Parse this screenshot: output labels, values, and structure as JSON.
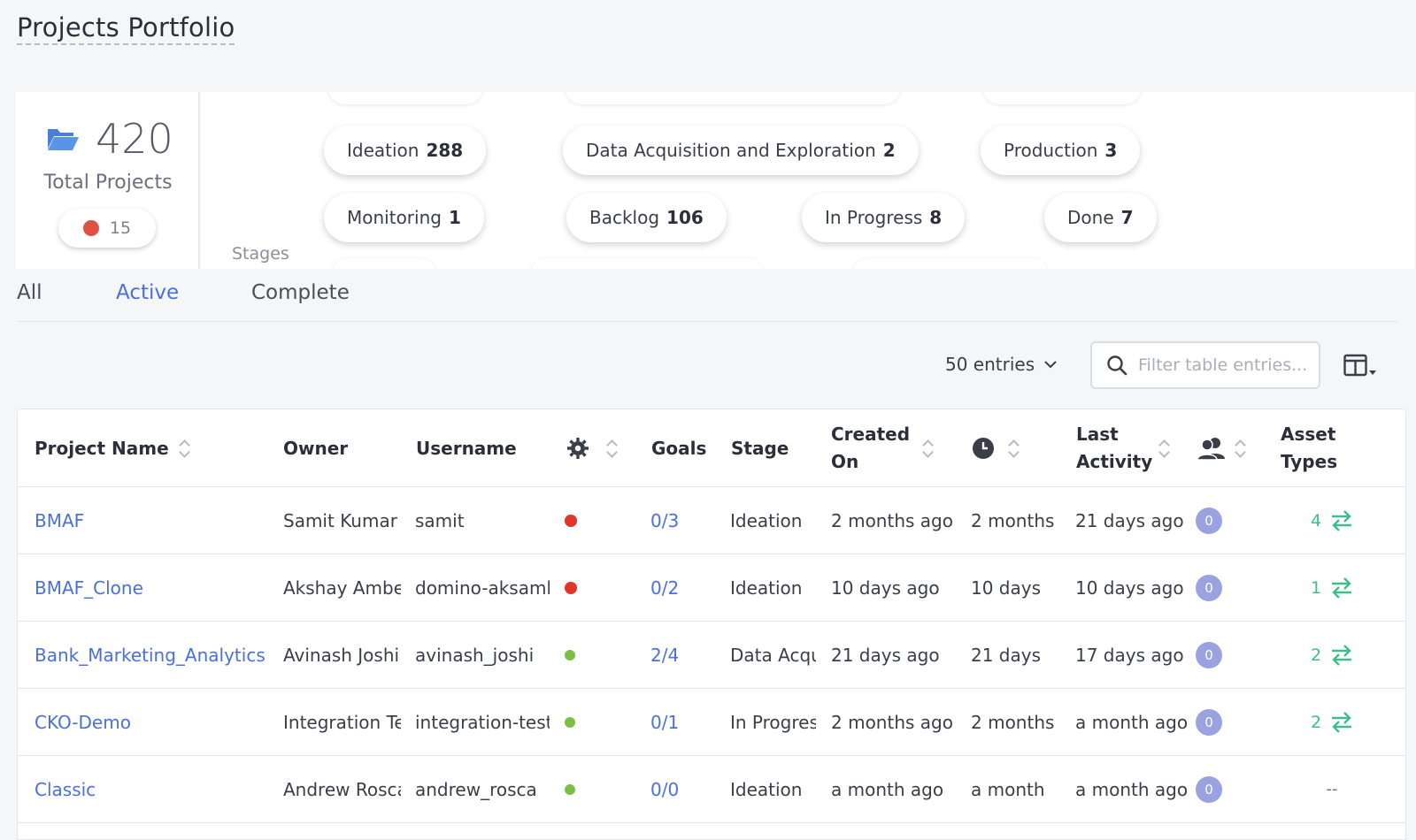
{
  "page": {
    "title": "Projects Portfolio"
  },
  "summary": {
    "total_count": "420",
    "total_label": "Total Projects",
    "risk_count": "15",
    "stages_label": "Stages",
    "stages": [
      {
        "name": "Ideation",
        "count": "288"
      },
      {
        "name": "Data Acquisition and Exploration",
        "count": "2"
      },
      {
        "name": "Production",
        "count": "3"
      },
      {
        "name": "Monitoring",
        "count": "1"
      },
      {
        "name": "Backlog",
        "count": "106"
      },
      {
        "name": "In Progress",
        "count": "8"
      },
      {
        "name": "Done",
        "count": "7"
      }
    ]
  },
  "tabs": [
    {
      "label": "All"
    },
    {
      "label": "Active"
    },
    {
      "label": "Complete"
    }
  ],
  "controls": {
    "entries_label": "50 entries",
    "search_placeholder": "Filter table entries..."
  },
  "table": {
    "headers": {
      "project_name": "Project Name",
      "owner": "Owner",
      "username": "Username",
      "goals": "Goals",
      "stage": "Stage",
      "created_on": "Created On",
      "last_activity": "Last Activity",
      "asset_types": "Asset Types"
    },
    "rows": [
      {
        "name": "BMAF",
        "owner": "Samit Kumar T",
        "username": "samit",
        "status": "red",
        "goals": "0/3",
        "stage": "Ideation",
        "created": "2 months ago",
        "duration": "2 months",
        "last_activity": "21 days ago",
        "collaborators": "0",
        "asset_count": "4",
        "asset_empty": ""
      },
      {
        "name": "BMAF_Clone",
        "owner": "Akshay Ambek",
        "username": "domino-aksamb",
        "status": "red",
        "goals": "0/2",
        "stage": "Ideation",
        "created": "10 days ago",
        "duration": "10 days",
        "last_activity": "10 days ago",
        "collaborators": "0",
        "asset_count": "1",
        "asset_empty": ""
      },
      {
        "name": "Bank_Marketing_Analytics",
        "owner": "Avinash Joshi",
        "username": "avinash_joshi",
        "status": "green",
        "goals": "2/4",
        "stage": "Data Acqu",
        "created": "21 days ago",
        "duration": "21 days",
        "last_activity": "17 days ago",
        "collaborators": "0",
        "asset_count": "2",
        "asset_empty": ""
      },
      {
        "name": "CKO-Demo",
        "owner": "Integration Tes",
        "username": "integration-test",
        "status": "green",
        "goals": "0/1",
        "stage": "In Progres",
        "created": "2 months ago",
        "duration": "2 months",
        "last_activity": "a month ago",
        "collaborators": "0",
        "asset_count": "2",
        "asset_empty": ""
      },
      {
        "name": "Classic",
        "owner": "Andrew Rosca",
        "username": "andrew_rosca",
        "status": "green",
        "goals": "0/0",
        "stage": "Ideation",
        "created": "a month ago",
        "duration": "a month",
        "last_activity": "a month ago",
        "collaborators": "0",
        "asset_count": "",
        "asset_empty": "--"
      }
    ]
  },
  "colors": {
    "accent": "#4a6fe0",
    "risk": "#e0362a",
    "ok": "#7ac143",
    "asset": "#3dbf8a",
    "badge": "#9aa3e0"
  }
}
